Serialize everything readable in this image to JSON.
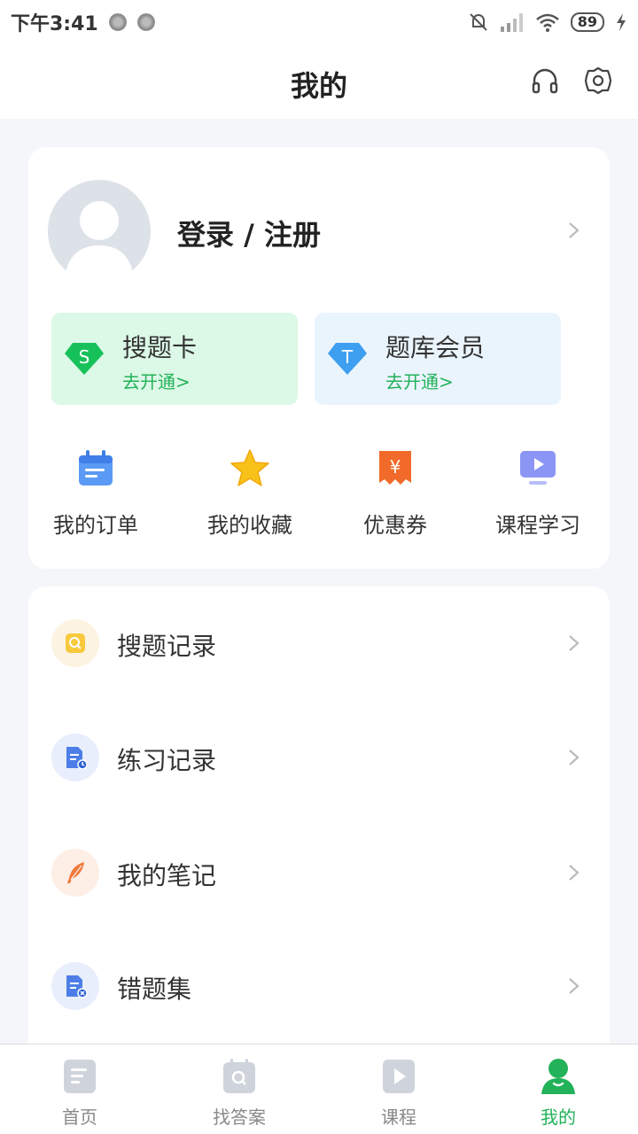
{
  "status_bar": {
    "time": "下午3:41",
    "battery": "89"
  },
  "header": {
    "title": "我的"
  },
  "profile": {
    "login_label": "登录 / 注册"
  },
  "vip_cards": [
    {
      "title": "搜题卡",
      "action": "去开通>"
    },
    {
      "title": "题库会员",
      "action": "去开通>"
    }
  ],
  "shortcuts": [
    {
      "label": "我的订单",
      "icon": "calendar-icon"
    },
    {
      "label": "我的收藏",
      "icon": "star-icon"
    },
    {
      "label": "优惠券",
      "icon": "coupon-icon"
    },
    {
      "label": "课程学习",
      "icon": "monitor-play-icon"
    }
  ],
  "menu": [
    {
      "label": "搜题记录",
      "icon": "search-doc-icon"
    },
    {
      "label": "练习记录",
      "icon": "practice-doc-icon"
    },
    {
      "label": "我的笔记",
      "icon": "feather-icon"
    },
    {
      "label": "错题集",
      "icon": "error-doc-icon"
    }
  ],
  "tabs": [
    {
      "label": "首页",
      "active": false
    },
    {
      "label": "找答案",
      "active": false
    },
    {
      "label": "课程",
      "active": false
    },
    {
      "label": "我的",
      "active": true
    }
  ],
  "colors": {
    "accent": "#22b25a",
    "background": "#f4f6f9"
  }
}
